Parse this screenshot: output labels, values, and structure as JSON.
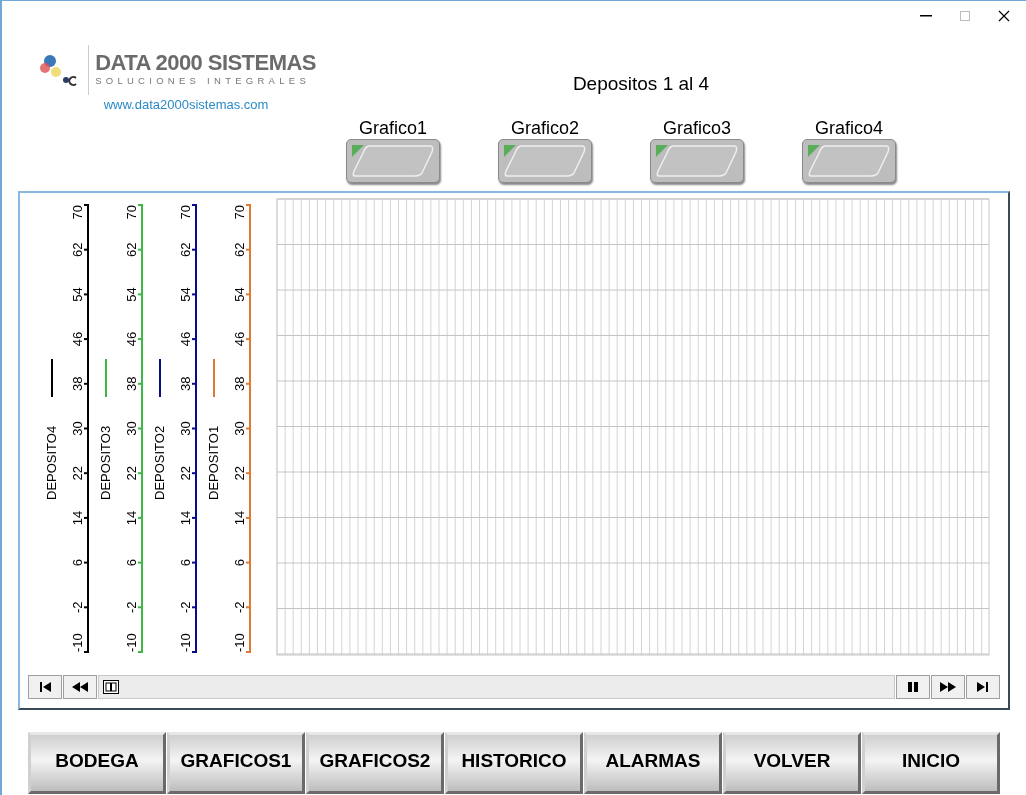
{
  "logo": {
    "name": "DATA 2000 SISTEMAS",
    "tagline": "SOLUCIONES INTEGRALES",
    "url": "www.data2000sistemas.com"
  },
  "title": "Depositos 1 al 4",
  "graph_buttons": [
    {
      "label": "Grafico1"
    },
    {
      "label": "Grafico2"
    },
    {
      "label": "Grafico3"
    },
    {
      "label": "Grafico4"
    }
  ],
  "trend_chart": {
    "axes": [
      {
        "label": "DEPOSITO4",
        "color": "#000000",
        "ticks": [
          "70",
          "62",
          "54",
          "46",
          "38",
          "30",
          "22",
          "14",
          "6",
          "-2",
          "-10"
        ]
      },
      {
        "label": "DEPOSITO3",
        "color": "#3cb846",
        "ticks": [
          "70",
          "62",
          "54",
          "46",
          "38",
          "30",
          "22",
          "14",
          "6",
          "-2",
          "-10"
        ]
      },
      {
        "label": "DEPOSITO2",
        "color": "#0a0a8c",
        "ticks": [
          "70",
          "62",
          "54",
          "46",
          "38",
          "30",
          "22",
          "14",
          "6",
          "-2",
          "-10"
        ]
      },
      {
        "label": "DEPOSITO1",
        "color": "#e07a30",
        "ticks": [
          "70",
          "62",
          "54",
          "46",
          "38",
          "30",
          "22",
          "14",
          "6",
          "-2",
          "-10"
        ]
      }
    ]
  },
  "nav_buttons": [
    {
      "label": "BODEGA"
    },
    {
      "label": "GRAFICOS1"
    },
    {
      "label": "GRAFICOS2"
    },
    {
      "label": "HISTORICO"
    },
    {
      "label": "ALARMAS"
    },
    {
      "label": "VOLVER"
    },
    {
      "label": "INICIO"
    }
  ]
}
